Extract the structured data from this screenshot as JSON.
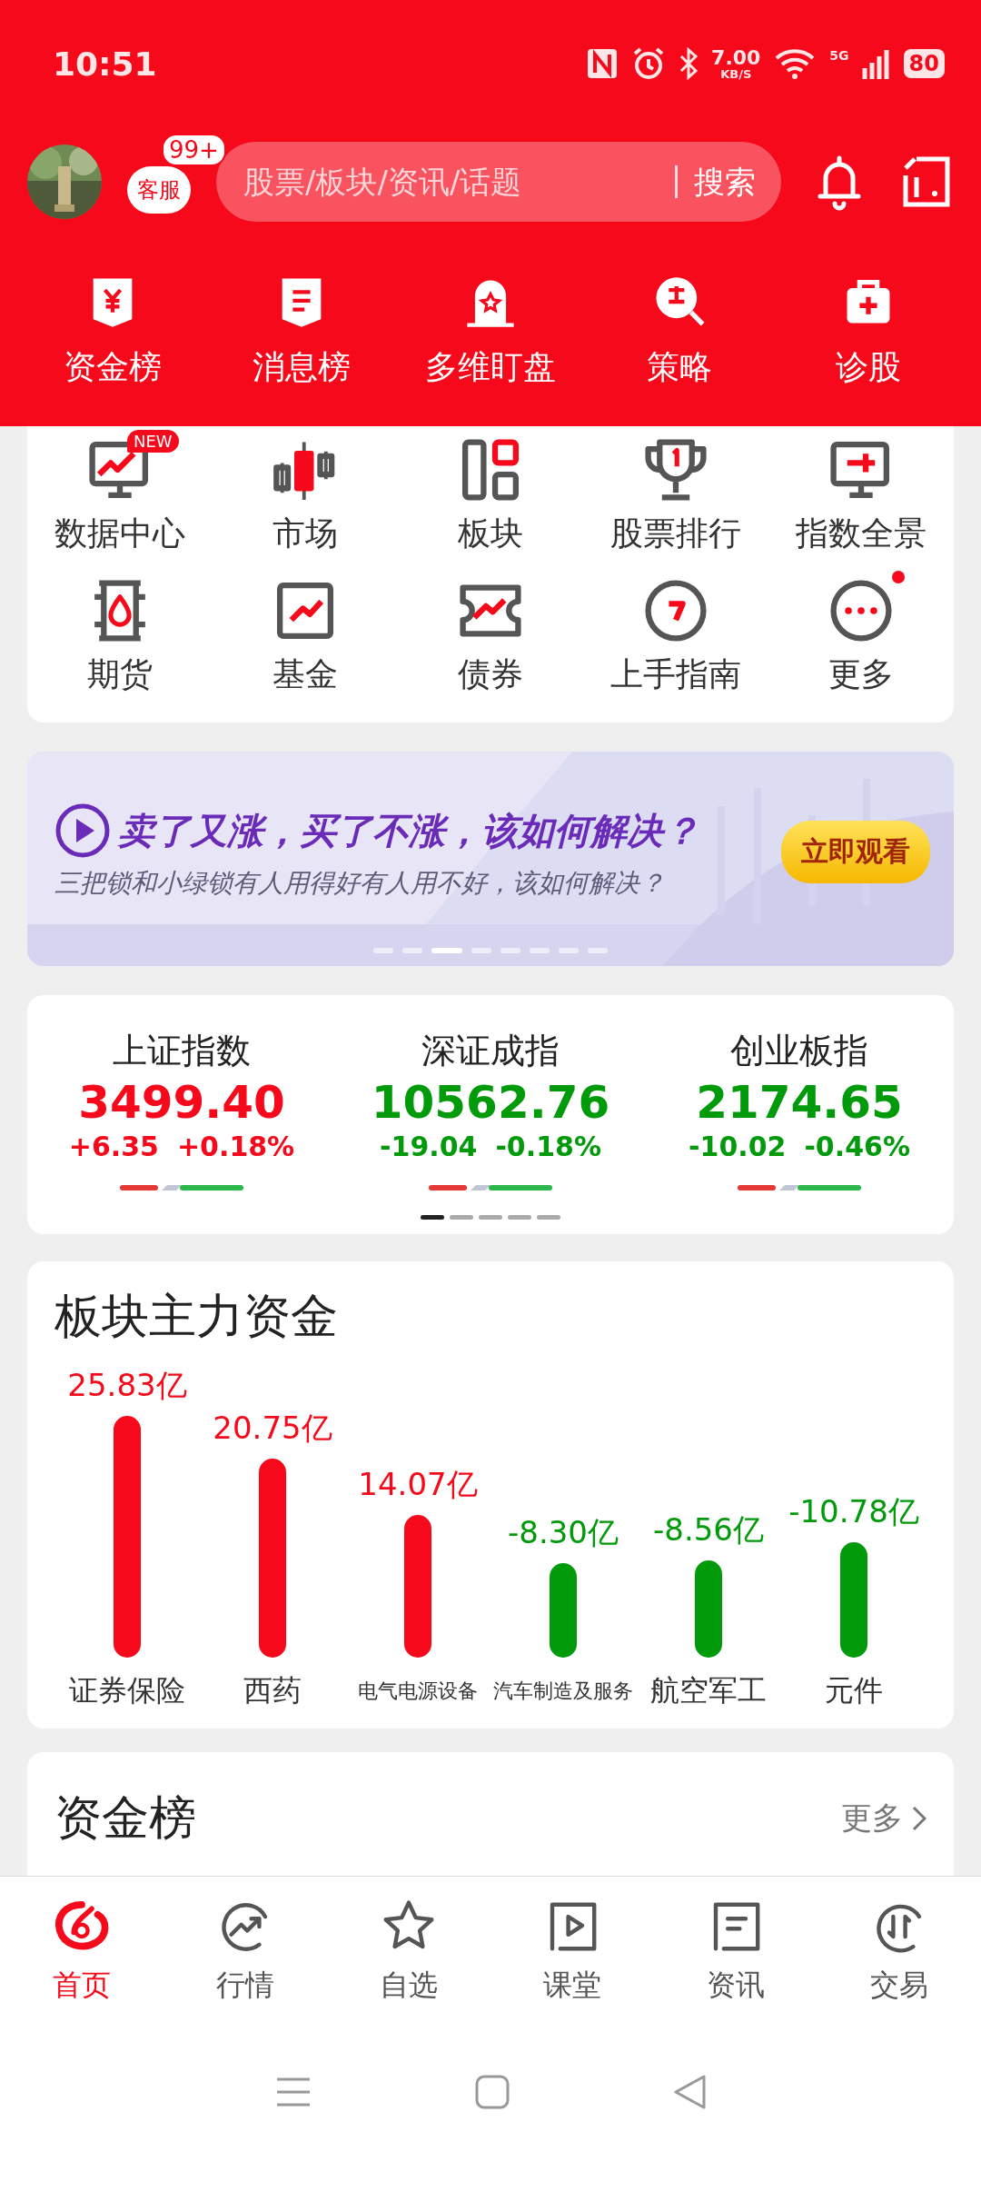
{
  "status_bar": {
    "time": "10:51",
    "speed": "7.00",
    "speed_unit": "KB/S",
    "network": "5G",
    "battery": "80"
  },
  "header": {
    "service": {
      "label": "客服",
      "badge": "99+"
    },
    "search": {
      "placeholder": "股票/板块/资讯/话题",
      "button": "搜索"
    }
  },
  "quick_links": [
    {
      "label": "资金榜"
    },
    {
      "label": "消息榜"
    },
    {
      "label": "多维盯盘"
    },
    {
      "label": "策略"
    },
    {
      "label": "诊股"
    }
  ],
  "grid_items": [
    {
      "label": "数据中心",
      "badge": "NEW",
      "dot": false
    },
    {
      "label": "市场",
      "dot": false
    },
    {
      "label": "板块",
      "dot": false
    },
    {
      "label": "股票排行",
      "dot": false
    },
    {
      "label": "指数全景",
      "dot": false
    },
    {
      "label": "期货",
      "dot": false
    },
    {
      "label": "基金",
      "dot": false
    },
    {
      "label": "债券",
      "dot": false
    },
    {
      "label": "上手指南",
      "dot": false
    },
    {
      "label": "更多",
      "dot": true
    }
  ],
  "banner": {
    "title": "卖了又涨，买了不涨，该如何解决？",
    "subtitle": "三把锁和小绿锁有人用得好有人用不好，该如何解决？",
    "button": "立即观看",
    "pages": [
      {
        "selected": false
      },
      {
        "selected": false
      },
      {
        "selected": true
      },
      {
        "selected": false
      },
      {
        "selected": false
      },
      {
        "selected": false
      },
      {
        "selected": false
      },
      {
        "selected": false
      }
    ]
  },
  "indices": {
    "items": [
      {
        "name": "上证指数",
        "value": "3499.40",
        "change": "+6.35",
        "percent": "+0.18%",
        "rising": true
      },
      {
        "name": "深证成指",
        "value": "10562.76",
        "change": "-19.04",
        "percent": "-0.18%",
        "rising": false
      },
      {
        "name": "创业板指",
        "value": "2174.65",
        "change": "-10.02",
        "percent": "-0.46%",
        "rising": false
      }
    ],
    "pages": [
      {
        "selected": true
      },
      {
        "selected": false
      },
      {
        "selected": false
      },
      {
        "selected": false
      },
      {
        "selected": false
      }
    ]
  },
  "sector_funds": {
    "title": "板块主力资金",
    "sectors": [
      {
        "name": "证券保险",
        "amount": "25.83亿",
        "inflow": true
      },
      {
        "name": "西药",
        "amount": "20.75亿",
        "inflow": true
      },
      {
        "name": "电气电源设备",
        "amount": "14.07亿",
        "inflow": true
      },
      {
        "name": "汽车制造及服务",
        "amount": "-8.30亿",
        "inflow": false
      },
      {
        "name": "航空军工",
        "amount": "-8.56亿",
        "inflow": false
      },
      {
        "name": "元件",
        "amount": "-10.78亿",
        "inflow": false
      }
    ]
  },
  "fund_rank": {
    "title": "资金榜",
    "more": "更多"
  },
  "tab_bar": [
    {
      "label": "首页",
      "selected": true
    },
    {
      "label": "行情",
      "selected": false
    },
    {
      "label": "自选",
      "selected": false
    },
    {
      "label": "课堂",
      "selected": false
    },
    {
      "label": "资讯",
      "selected": false
    },
    {
      "label": "交易",
      "selected": false
    }
  ]
}
